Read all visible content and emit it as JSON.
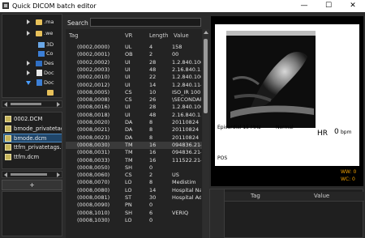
{
  "window": {
    "title": "Quick DICOM batch editor",
    "minimize_glyph": "—",
    "maximize_glyph": "☐",
    "close_glyph": "✕"
  },
  "tree": {
    "items": [
      {
        "label": ".ma",
        "icon": "folder-icon",
        "expander": "collapsed"
      },
      {
        "label": ".we",
        "icon": "folder-icon",
        "expander": "collapsed"
      },
      {
        "label": "3D",
        "icon": "objects-3d-icon",
        "expander": "none"
      },
      {
        "label": "Co",
        "icon": "computer-icon",
        "expander": "none"
      },
      {
        "label": "Des",
        "icon": "desktop-icon",
        "expander": "collapsed"
      },
      {
        "label": "Doc",
        "icon": "documents-icon",
        "expander": "collapsed"
      },
      {
        "label": "Doc",
        "icon": "documents-icon",
        "expander": "expanded"
      }
    ]
  },
  "files": [
    {
      "name": "0002.DCM",
      "selected": false
    },
    {
      "name": "bmode_privatetags.dcm",
      "selected": false
    },
    {
      "name": "bmode.dcm",
      "selected": true
    },
    {
      "name": "ttfm_privatetags.dcm",
      "selected": false
    },
    {
      "name": "ttfm.dcm",
      "selected": false
    }
  ],
  "add_button_label": "+",
  "search": {
    "label": "Search",
    "value": ""
  },
  "table": {
    "columns": [
      "Tag",
      "VR",
      "Length",
      "Value"
    ],
    "rows": [
      {
        "tag": "(0002,0000)",
        "vr": "UL",
        "length": "4",
        "value": "158",
        "selected": false
      },
      {
        "tag": "(0002,0001)",
        "vr": "OB",
        "length": "2",
        "value": "00",
        "selected": false
      },
      {
        "tag": "(0002,0002)",
        "vr": "UI",
        "length": "28",
        "value": "1.2.840.100",
        "selected": false
      },
      {
        "tag": "(0002,0003)",
        "vr": "UI",
        "length": "48",
        "value": "2.16.840.1.1",
        "selected": false
      },
      {
        "tag": "(0002,0010)",
        "vr": "UI",
        "length": "22",
        "value": "1.2.840.100",
        "selected": false
      },
      {
        "tag": "(0002,0012)",
        "vr": "UI",
        "length": "14",
        "value": "1.2.840.114",
        "selected": false
      },
      {
        "tag": "(0008,0005)",
        "vr": "CS",
        "length": "10",
        "value": "ISO_IR 100",
        "selected": false
      },
      {
        "tag": "(0008,0008)",
        "vr": "CS",
        "length": "26",
        "value": "\\SECONDAR",
        "selected": false
      },
      {
        "tag": "(0008,0016)",
        "vr": "UI",
        "length": "28",
        "value": "1.2.840.100",
        "selected": false
      },
      {
        "tag": "(0008,0018)",
        "vr": "UI",
        "length": "48",
        "value": "2.16.840.1.1",
        "selected": false
      },
      {
        "tag": "(0008,0020)",
        "vr": "DA",
        "length": "8",
        "value": "20110824",
        "selected": false
      },
      {
        "tag": "(0008,0021)",
        "vr": "DA",
        "length": "8",
        "value": "20110824",
        "selected": false
      },
      {
        "tag": "(0008,0023)",
        "vr": "DA",
        "length": "8",
        "value": "20110824",
        "selected": false
      },
      {
        "tag": "(0008,0030)",
        "vr": "TM",
        "length": "16",
        "value": "094836.214",
        "selected": true
      },
      {
        "tag": "(0008,0031)",
        "vr": "TM",
        "length": "16",
        "value": "094836.214",
        "selected": false
      },
      {
        "tag": "(0008,0033)",
        "vr": "TM",
        "length": "16",
        "value": "111522.214",
        "selected": false
      },
      {
        "tag": "(0008,0050)",
        "vr": "SH",
        "length": "0",
        "value": "",
        "selected": false
      },
      {
        "tag": "(0008,0060)",
        "vr": "CS",
        "length": "2",
        "value": "US",
        "selected": false
      },
      {
        "tag": "(0008,0070)",
        "vr": "LO",
        "length": "8",
        "value": "Medistim",
        "selected": false
      },
      {
        "tag": "(0008,0080)",
        "vr": "LO",
        "length": "14",
        "value": "Hospital Na",
        "selected": false
      },
      {
        "tag": "(0008,0081)",
        "vr": "ST",
        "length": "30",
        "value": "Hospital Add",
        "selected": false
      },
      {
        "tag": "(0008,0090)",
        "vr": "PN",
        "length": "0",
        "value": "",
        "selected": false
      },
      {
        "tag": "(0008,1010)",
        "vr": "SH",
        "length": "6",
        "value": "VERIQ",
        "selected": false
      },
      {
        "tag": "(0008,1030)",
        "vr": "LO",
        "length": "0",
        "value": "",
        "selected": false
      }
    ]
  },
  "viewer": {
    "overlay_left": "Epicardial 15 MHz",
    "overlay_mid": "Normal",
    "overlay_hr": "HR",
    "overlay_hr_value": "0",
    "overlay_bpm": "bpm",
    "overlay_ww": "WW: 0",
    "overlay_wc": "WC: 0",
    "overlay_pos": "POS"
  },
  "tag_table": {
    "columns": [
      "Tag",
      "Value"
    ]
  },
  "colors": {
    "background": "#2b2b2b",
    "selection": "#20466a",
    "overlay_accent": "#f0a000"
  }
}
